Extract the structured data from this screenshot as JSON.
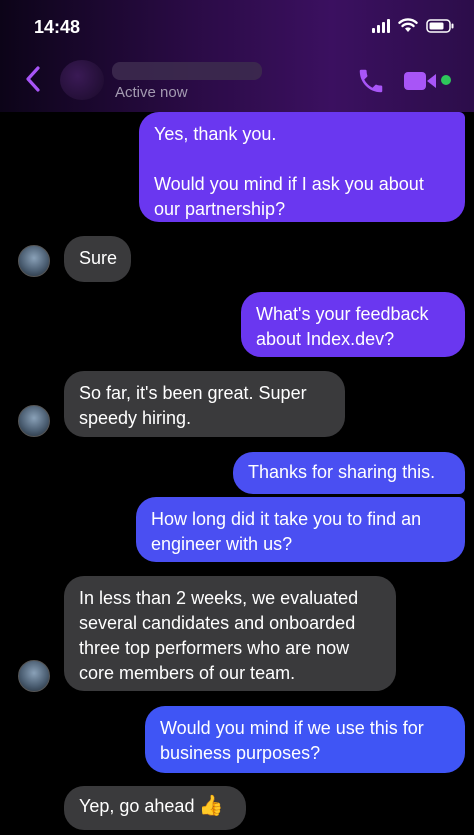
{
  "status_bar": {
    "time": "14:48"
  },
  "header": {
    "active_status": "Active now",
    "colors": {
      "accent": "#a855f7",
      "online": "#2ec65b"
    }
  },
  "messages": [
    {
      "side": "out",
      "lines": [
        "Yes, thank you.",
        "",
        "Would you mind if I ask you about",
        "our partnership?"
      ]
    },
    {
      "side": "in",
      "lines": [
        "Sure"
      ]
    },
    {
      "side": "out",
      "lines": [
        "What's your feedback",
        "about Index.dev?"
      ]
    },
    {
      "side": "in",
      "lines": [
        "So far, it's been great. Super",
        "speedy hiring."
      ]
    },
    {
      "side": "out",
      "lines": [
        "Thanks for sharing this."
      ]
    },
    {
      "side": "out",
      "lines": [
        "How long did it take you to find an",
        "engineer with us?"
      ]
    },
    {
      "side": "in",
      "lines": [
        "In less than 2 weeks, we evaluated",
        "several candidates and onboarded",
        "three top performers who are now",
        "core members of our team."
      ]
    },
    {
      "side": "out",
      "lines": [
        "Would you mind if we use this for",
        "business purposes?"
      ]
    },
    {
      "side": "in",
      "lines": [
        "Yep, go ahead"
      ],
      "emoji": "👍"
    }
  ]
}
